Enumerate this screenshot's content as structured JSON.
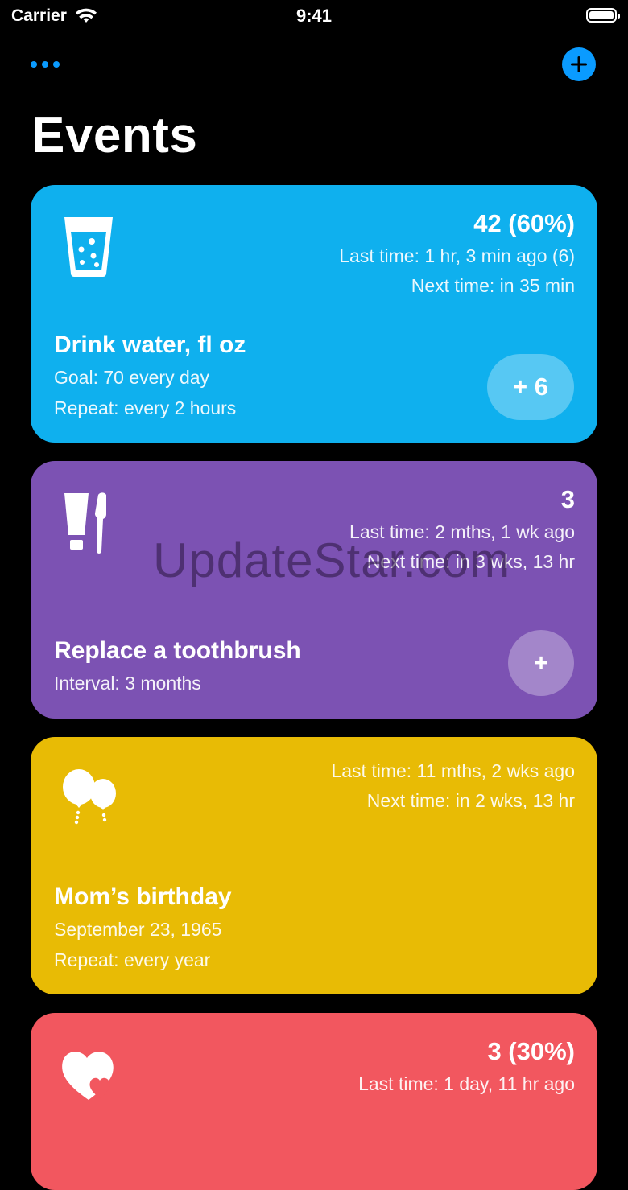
{
  "status_bar": {
    "carrier": "Carrier",
    "time": "9:41"
  },
  "header": {
    "title": "Events"
  },
  "events": [
    {
      "name": "Drink water, fl oz",
      "count": "42 (60%)",
      "last_time": "Last time: 1 hr, 3 min ago (6)",
      "next_time": "Next time: in 35 min",
      "goal": "Goal: 70 every day",
      "repeat": "Repeat: every 2 hours",
      "button": "+ 6",
      "icon": "water-glass-icon",
      "color": "#0fb0ee"
    },
    {
      "name": "Replace a toothbrush",
      "count": "3",
      "last_time": "Last time: 2 mths, 1 wk ago",
      "next_time": "Next time: in 3 wks, 13 hr",
      "interval": "Interval: 3 months",
      "button": "+",
      "icon": "toothbrush-toothpaste-icon",
      "color": "#7c52b3"
    },
    {
      "name": "Mom’s birthday",
      "last_time": "Last time: 11 mths, 2 wks ago",
      "next_time": "Next time: in 2 wks, 13 hr",
      "date": "September 23, 1965",
      "repeat": "Repeat: every year",
      "icon": "balloons-icon",
      "color": "#e8bb05"
    },
    {
      "count": "3 (30%)",
      "last_time": "Last time: 1 day, 11 hr ago",
      "icon": "hearts-icon",
      "color": "#f2575f"
    }
  ],
  "watermark": "UpdateStar.com"
}
